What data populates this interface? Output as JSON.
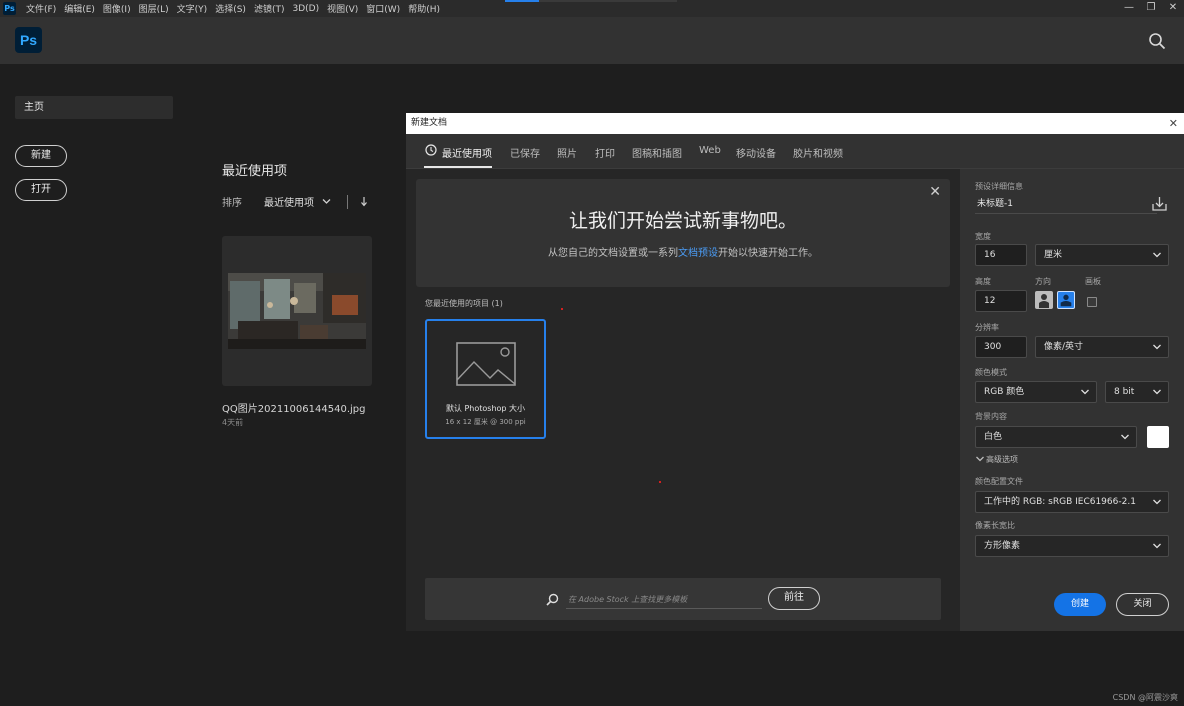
{
  "menubar": {
    "app_icon": "Ps",
    "items": [
      "文件(F)",
      "编辑(E)",
      "图像(I)",
      "图层(L)",
      "文字(Y)",
      "选择(S)",
      "滤镜(T)",
      "3D(D)",
      "视图(V)",
      "窗口(W)",
      "帮助(H)"
    ],
    "window_controls": [
      "—",
      "❐",
      "✕"
    ]
  },
  "header": {
    "logo": "Ps",
    "search_icon": "search-icon"
  },
  "sidebar": {
    "home": "主页",
    "new_button": "新建",
    "open_button": "打开"
  },
  "recent": {
    "title": "最近使用项",
    "sort_label": "排序",
    "sort_value": "最近使用项",
    "file_name": "QQ图片20211006144540.jpg",
    "file_time": "4天前"
  },
  "dialog": {
    "title": "新建文档",
    "close": "✕",
    "tabs": [
      "最近使用项",
      "已保存",
      "照片",
      "打印",
      "图稿和插图",
      "Web",
      "移动设备",
      "胶片和视频"
    ],
    "active_tab": 0,
    "banner": {
      "title": "让我们开始尝试新事物吧。",
      "sub_before": "从您自己的文档设置或一系列",
      "sub_link": "文档预设",
      "sub_after": "开始以快速开始工作。"
    },
    "recent_items_label": "您最近使用的项目 (1)",
    "preset": {
      "name": "默认 Photoshop 大小",
      "size": "16 x 12 厘米 @ 300 ppi"
    },
    "stock": {
      "placeholder": "在 Adobe Stock 上查找更多模板",
      "go_button": "前往"
    }
  },
  "details": {
    "section_title": "预设详细信息",
    "doc_name": "未标题-1",
    "width_label": "宽度",
    "width_value": "16",
    "width_unit": "厘米",
    "height_label": "高度",
    "height_value": "12",
    "orientation_label": "方向",
    "artboard_label": "画板",
    "resolution_label": "分辨率",
    "resolution_value": "300",
    "resolution_unit": "像素/英寸",
    "color_mode_label": "颜色模式",
    "color_mode": "RGB 颜色",
    "bit_depth": "8 bit",
    "background_label": "背景内容",
    "background": "白色",
    "background_color": "#ffffff",
    "advanced_label": "高级选项",
    "color_profile_label": "颜色配置文件",
    "color_profile": "工作中的 RGB: sRGB IEC61966-2.1",
    "pixel_aspect_label": "像素长宽比",
    "pixel_aspect": "方形像素",
    "create_button": "创建",
    "close_button": "关闭"
  },
  "colors": {
    "accent": "#2680eb",
    "primary_button": "#1473e6",
    "link": "#4b9cf5"
  },
  "watermark": "CSDN @阿震沙爽"
}
